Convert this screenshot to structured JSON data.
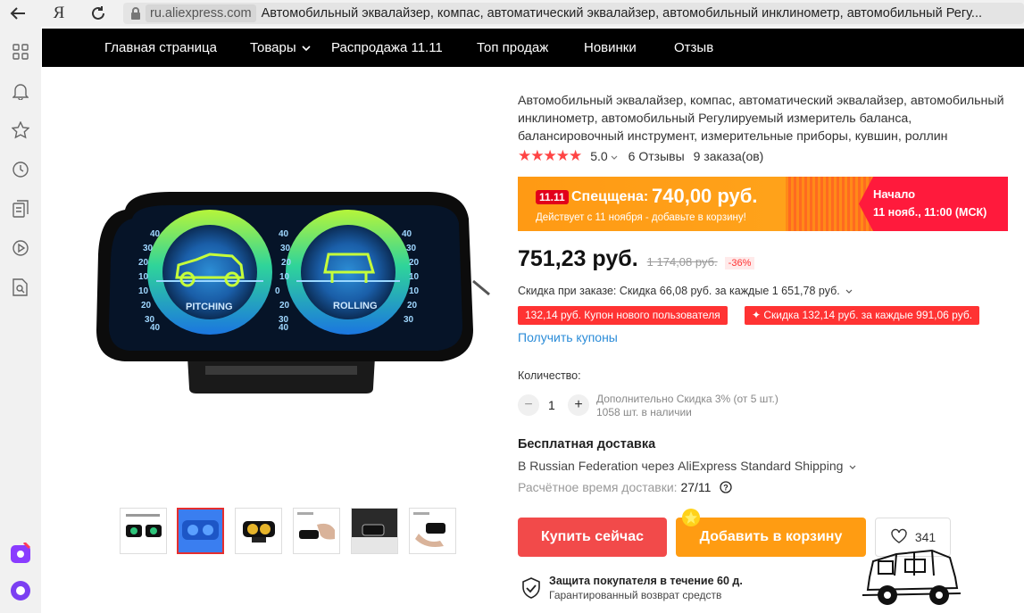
{
  "browser": {
    "ya_label": "Я",
    "domain": "ru.aliexpress.com",
    "tab_title": "Автомобильный эквалайзер, компас, автоматический эквалайзер, автомобильный инклинометр, автомобильный Регу..."
  },
  "nav": {
    "items": [
      "Главная страница",
      "Товары",
      "Распродажа 11.11",
      "Топ продаж",
      "Новинки",
      "Отзыв"
    ]
  },
  "product": {
    "title": "Автомобильный эквалайзер, компас, автоматический эквалайзер, автомобильный инклинометр, автомобильный Регулируемый измеритель баланса, балансировочный инструмент, измерительные приборы, кувшин, роллин",
    "stars": "★★★★★",
    "rating": "5.0",
    "reviews": "6 Отзывы",
    "orders": "9 заказа(ов)",
    "image_gauge_left_label": "PITCHING",
    "image_gauge_right_label": "ROLLING"
  },
  "promo": {
    "badge": "11.11",
    "label": "Спецщена:",
    "price": "740,00 руб.",
    "sub": "Действует с 11 ноября - добавьте в корзину!",
    "start_label": "Начало",
    "start_date": "11 нояб., 11:00 (МСК)"
  },
  "pricing": {
    "price": "751,23 руб.",
    "old_price": "1 174,08 руб.",
    "discount": "-36%",
    "savings": "Скидка при заказе: Скидка 66,08 руб. за каждые 1 651,78 руб.",
    "coupon_new_user": "132,14 руб. Купон нового пользователя",
    "coupon_store": "✦ Скидка 132,14 руб. за каждые 991,06 руб.",
    "get_coupons": "Получить купоны"
  },
  "quantity": {
    "label": "Количество:",
    "value": "1",
    "extra_discount": "Дополнительно Скидка 3% (от 5 шт.)",
    "stock": "1058 шт. в наличии"
  },
  "shipping": {
    "title": "Бесплатная доставка",
    "via": "В Russian Federation через AliExpress Standard Shipping",
    "time_label": "Расчётное время доставки:",
    "time_value": "27/11"
  },
  "actions": {
    "buy_now": "Купить сейчас",
    "add_to_cart": "Добавить в корзину",
    "wishlist_count": "341"
  },
  "protection": {
    "title": "Защита покупателя в течение 60 д.",
    "subtitle": "Гарантированный возврат средств"
  },
  "colors": {
    "nav_bg": "#000000",
    "accent_red": "#f24a4a",
    "accent_orange": "#ff9c12",
    "link_blue": "#2b8cd8",
    "promo_red": "#ff1a3c"
  },
  "icons": {
    "sidebar": [
      "grid-icon",
      "bell-icon",
      "star-icon",
      "history-icon",
      "collections-icon",
      "play-icon",
      "search-doc-icon",
      "alice-app-icon",
      "alice-icon"
    ]
  }
}
